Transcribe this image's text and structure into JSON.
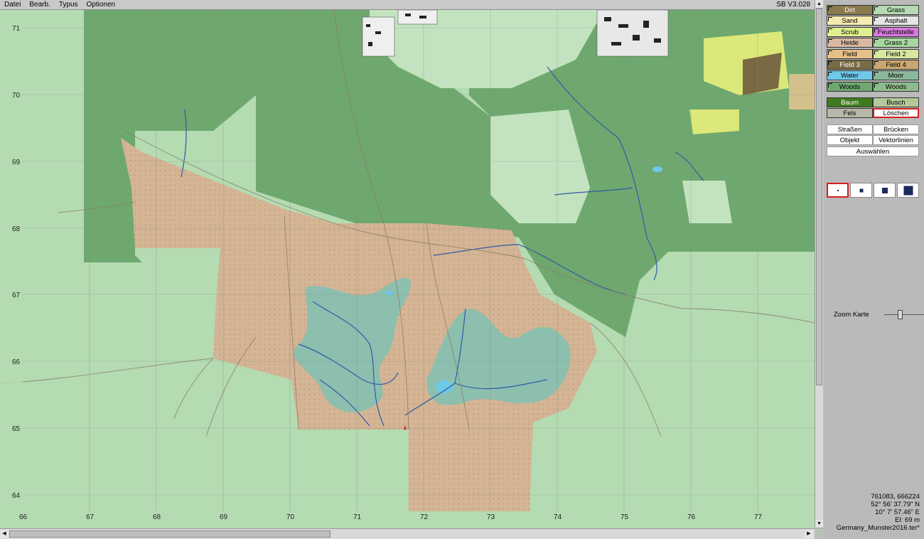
{
  "menu": [
    "Datei",
    "Bearb.",
    "Typus",
    "Optionen"
  ],
  "version": "SB V3.028",
  "map": {
    "y_ticks": [
      "71",
      "70",
      "69",
      "68",
      "67",
      "66",
      "65",
      "64"
    ],
    "x_ticks": [
      "66",
      "67",
      "68",
      "69",
      "70",
      "71",
      "72",
      "73",
      "74",
      "75",
      "76",
      "77"
    ]
  },
  "terrain_types": [
    {
      "label": "Dirt",
      "color": "#8a7a4c"
    },
    {
      "label": "Grass",
      "color": "#b4dbb2"
    },
    {
      "label": "Sand",
      "color": "#f4ebb0"
    },
    {
      "label": "Asphalt",
      "color": "#e5e5e5"
    },
    {
      "label": "Scrub",
      "color": "#dff08c"
    },
    {
      "label": "Feuchtstelle",
      "color": "#d77be0"
    },
    {
      "label": "Heide",
      "color": "#d8b8a0"
    },
    {
      "label": "Grass 2",
      "color": "#a8d8a0"
    },
    {
      "label": "Field",
      "color": "#e5c088"
    },
    {
      "label": "Field 2",
      "color": "#d8e8a0"
    },
    {
      "label": "Field 3",
      "color": "#7a6a44"
    },
    {
      "label": "Field 4",
      "color": "#c8a870"
    },
    {
      "label": "Water",
      "color": "#6ec8e8"
    },
    {
      "label": "Moor",
      "color": "#8ab89a"
    },
    {
      "label": "Woods",
      "color": "#6ea86e"
    },
    {
      "label": "Woods",
      "color": "#8cbc8c"
    }
  ],
  "vegetation": [
    {
      "label": "Baum",
      "color": "#3f7a1e"
    },
    {
      "label": "Busch",
      "color": "#b4c89a"
    },
    {
      "label": "Fels",
      "color": "#b8b8a8"
    },
    {
      "label": "Löschen",
      "color": "#ffffff"
    }
  ],
  "tools": [
    "Straßen",
    "Brücken",
    "Objekt",
    "Vektorlinien",
    "Auswählen"
  ],
  "brush_sizes": 4,
  "zoom_label": "Zoom Karte",
  "zoom_level": 0.35,
  "status": {
    "coords": "761083, 666224",
    "lat": "52° 56' 37.79\" N",
    "lon": "10° 7' 57.46\" E",
    "elevation": "El: 69 m",
    "file": "Germany_Munster2016.ter*"
  }
}
